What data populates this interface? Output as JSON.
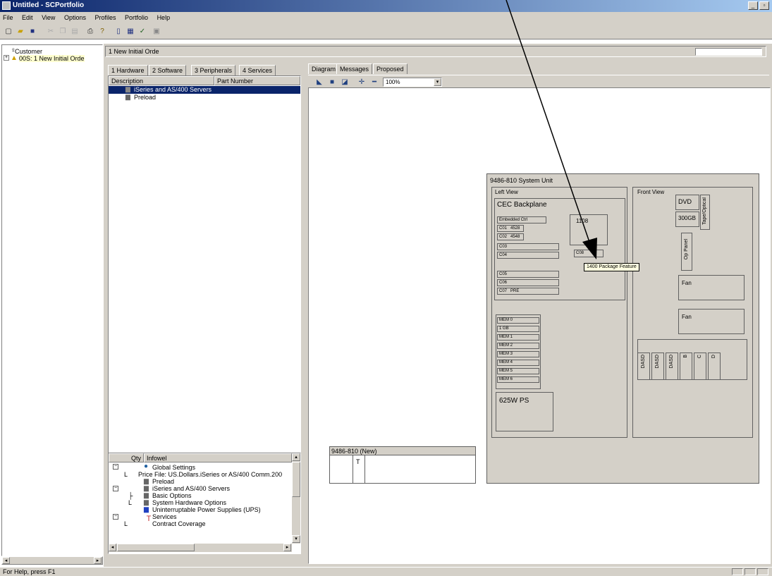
{
  "window": {
    "title": "Untitled - SCPortfolio",
    "min": "_",
    "max": "▫",
    "close": "×"
  },
  "menu": [
    "File",
    "Edit",
    "View",
    "Options",
    "Profiles",
    "Portfolio",
    "Help"
  ],
  "left_tree": {
    "items": [
      {
        "label": "Customer"
      },
      {
        "label": "00S: 1 New Initial Orde"
      }
    ]
  },
  "order_header": {
    "title": "1 New Initial Orde"
  },
  "hardware_tabs": [
    "1 Hardware",
    "2 Software",
    "3 Peripherals",
    "4 Services"
  ],
  "hardware_list": {
    "col_description": "Description",
    "col_part_number": "Part Number",
    "rows": [
      {
        "label": "iSeries and AS/400 Servers",
        "selected": true
      },
      {
        "label": "Preload",
        "selected": false
      }
    ]
  },
  "bottom_list": {
    "col_qty": "Qty",
    "col_item": "Infowel",
    "rows": [
      {
        "label": "Global Settings"
      },
      {
        "label": "Price File: US.Dollars.iSeries or AS/400 Comm.200"
      },
      {
        "label": "Preload"
      },
      {
        "label": "iSeries and AS/400 Servers"
      },
      {
        "label": "Basic Options"
      },
      {
        "label": "System Hardware Options"
      },
      {
        "label": "Uninterruptable Power Supplies (UPS)"
      },
      {
        "label": "Services"
      },
      {
        "label": "Contract Coverage"
      }
    ]
  },
  "diagram_tabs": [
    "Diagram",
    "Messages",
    "Proposed"
  ],
  "zoom": {
    "value": "100%"
  },
  "system_unit": {
    "title": "9486-810 System Unit",
    "left_view": "Left View",
    "backplane": "CEC Backplane",
    "front_view": "Front View",
    "dvd": "DVD",
    "tape": "Tape/Optical",
    "dasd": "300GB",
    "op_panel": "Op Panel",
    "fan1": "Fan",
    "fan2": "Fan",
    "ps": "625W PS",
    "chip": "1108",
    "tooltip": "1400 Package Feature"
  },
  "slot_labels": {
    "embedded": "Embedded Ctrl",
    "l1": "C01",
    "l2": "C02",
    "l3": "C03",
    "l4": "C04",
    "l5": "C05",
    "l6": "C06",
    "l7": "C07",
    "l8": "C08",
    "v1": "4528",
    "v2": "4548",
    "mem": [
      "MEM 0",
      "1 GB",
      "MEM 1",
      "MEM 2",
      "MEM 3",
      "MEM 4",
      "MEM 5",
      "MEM 6"
    ],
    "bays": [
      "DASD",
      "DASD",
      "DASD",
      "B",
      "C",
      "D"
    ],
    "pre": "PRE"
  },
  "new_unit": {
    "title": "9486-810 (New)",
    "col": "T"
  },
  "status": {
    "text": "For Help, press F1"
  }
}
